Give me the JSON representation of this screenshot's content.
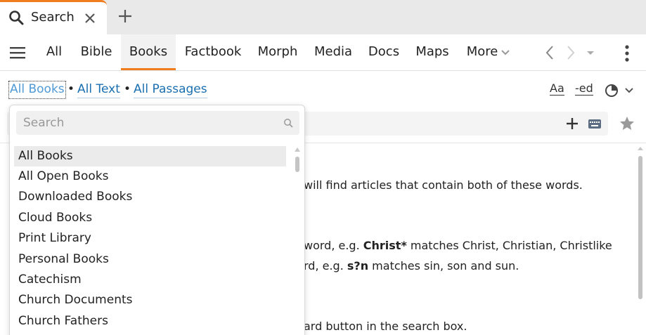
{
  "tab": {
    "title": "Search",
    "icon": "search-icon"
  },
  "nav": {
    "items": [
      {
        "label": "All"
      },
      {
        "label": "Bible"
      },
      {
        "label": "Books"
      },
      {
        "label": "Factbook"
      },
      {
        "label": "Morph"
      },
      {
        "label": "Media"
      },
      {
        "label": "Docs"
      },
      {
        "label": "Maps"
      },
      {
        "label": "More"
      }
    ],
    "active": "Books"
  },
  "scope": {
    "books": "All Books",
    "text": "All Text",
    "passages": "All Passages",
    "separator": "•"
  },
  "tools": {
    "font_size": "Aa",
    "inflected": "-ed"
  },
  "dropdown": {
    "search_placeholder": "Search",
    "items": [
      "All Books",
      "All Open Books",
      "Downloaded Books",
      "Cloud Books",
      "Print Library",
      "Personal Books",
      "Catechism",
      "Church Documents",
      "Church Fathers"
    ],
    "selected": "All Books"
  },
  "content": {
    "line1": "will find articles that contain both of these words.",
    "line2_pre": "word, e.g. ",
    "line2_bold": "Christ*",
    "line2_post": " matches Christ, Christian, Christlike",
    "line3_pre": "rd, e.g. ",
    "line3_bold": "s?n",
    "line3_post": " matches sin, son and sun.",
    "line4": "ard button in the search box."
  },
  "colors": {
    "accent": "#f07d1e",
    "link": "#1a6fb0",
    "link_light": "#4f9ad6"
  }
}
